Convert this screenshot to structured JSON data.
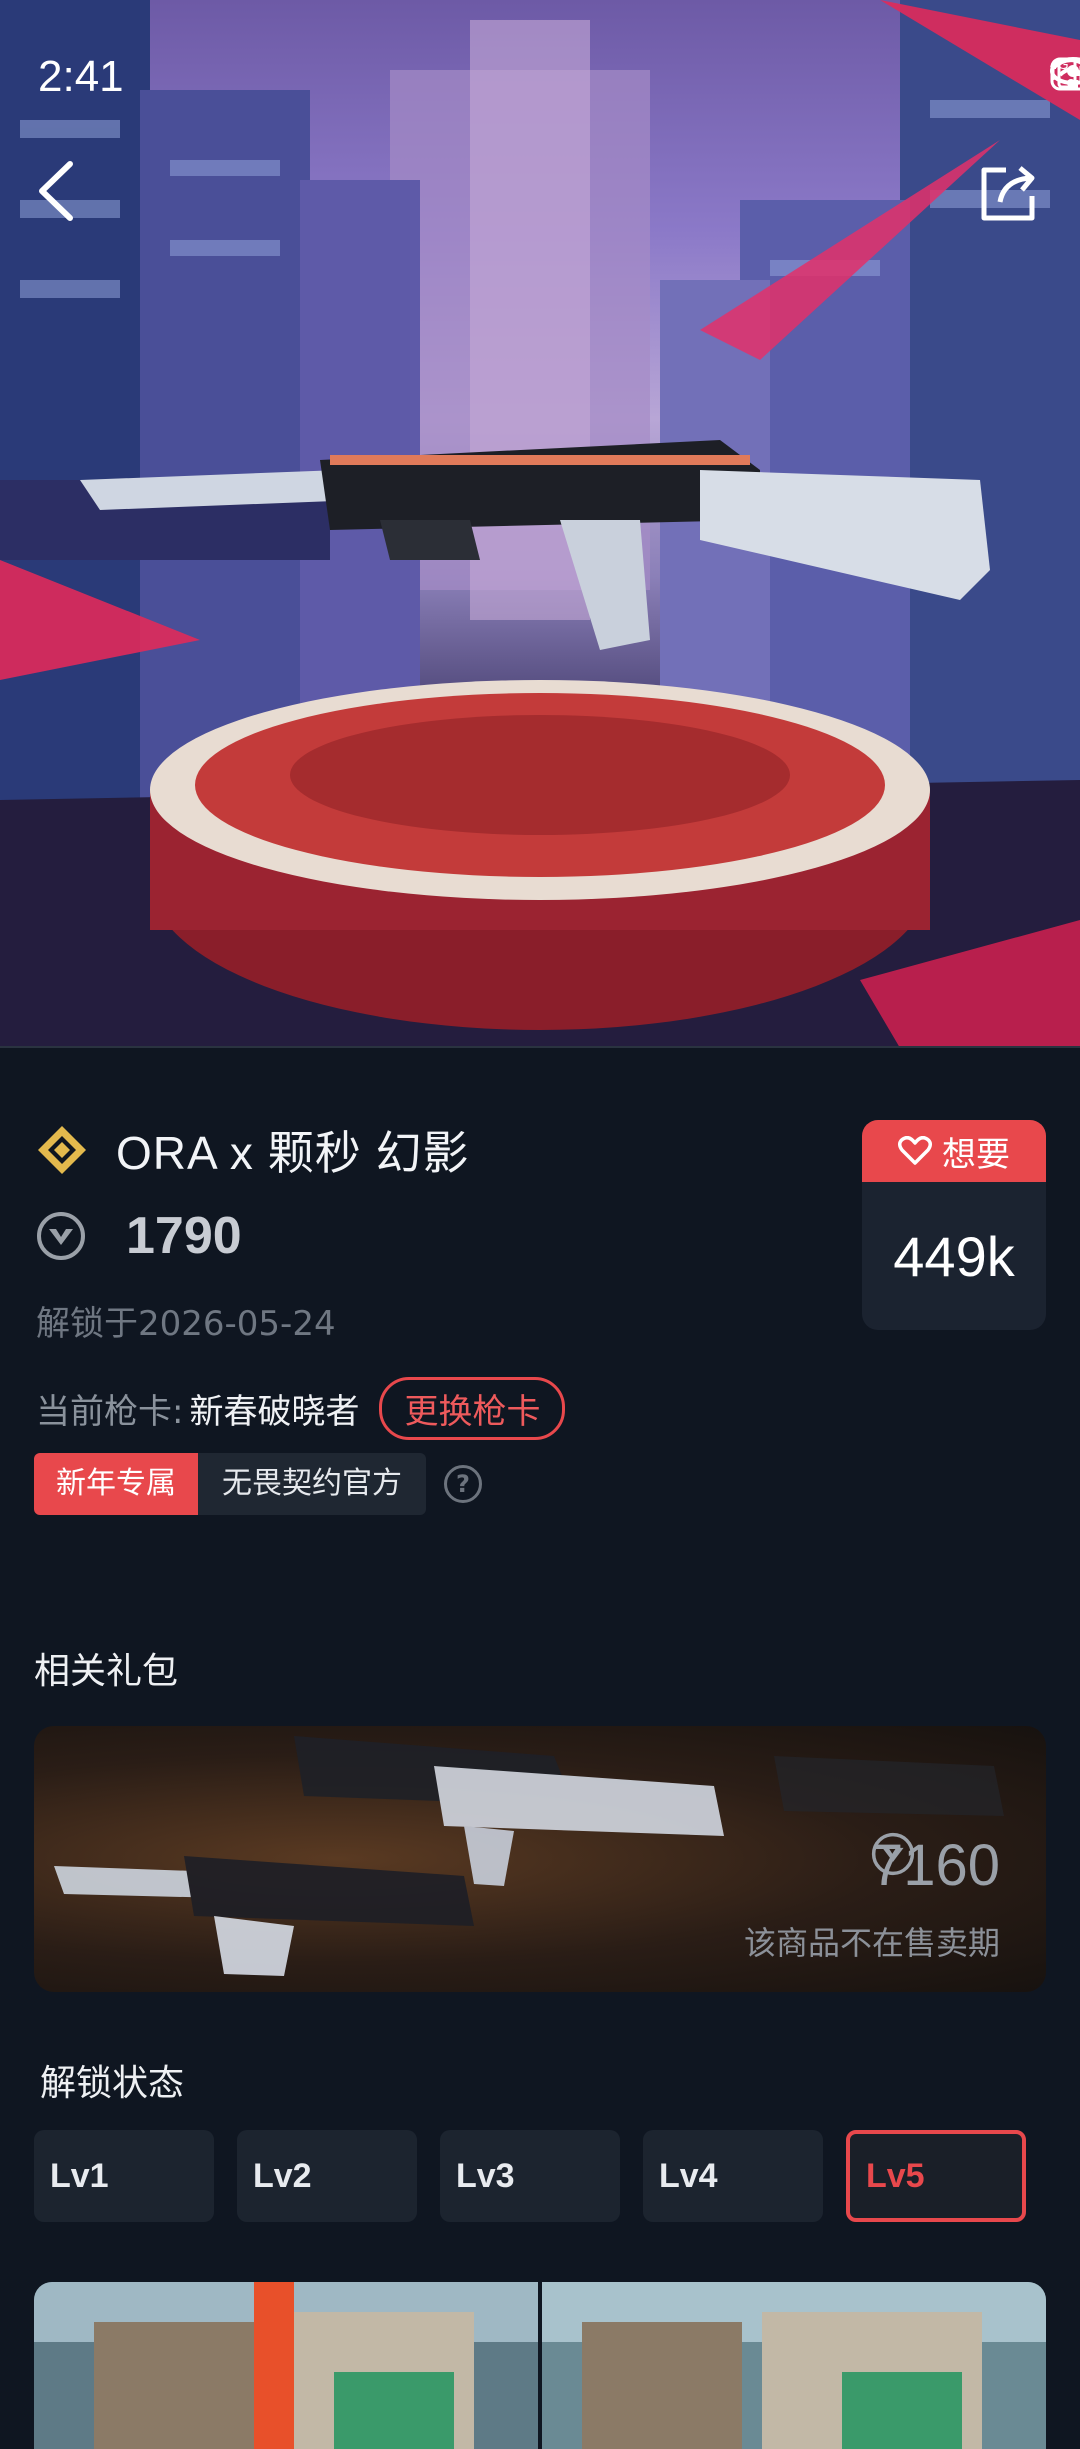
{
  "status_bar": {
    "time": "2:41",
    "signal_label": "4G",
    "signal_superscript": "6"
  },
  "item": {
    "title": "ORA x 颗秒 幻影",
    "price": "1790",
    "unlock_date": "解锁于2026-05-24",
    "current_card_label": "当前枪卡:",
    "current_card_name": "新春破晓者",
    "change_card_label": "更换枪卡",
    "tags": [
      "新年专属",
      "无畏契约官方"
    ],
    "help": "?"
  },
  "want": {
    "label": "想要",
    "count": "449k"
  },
  "bundle_section": {
    "title": "相关礼包",
    "price": "7160",
    "note": "该商品不在售卖期"
  },
  "unlock_section": {
    "title": "解锁状态",
    "levels": [
      "Lv1",
      "Lv2",
      "Lv3",
      "Lv4",
      "Lv5"
    ],
    "selected": "Lv5"
  },
  "colors": {
    "accent": "#e8484c",
    "background": "#0f1621",
    "card": "#1c242f"
  },
  "icons": [
    "back-arrow-icon",
    "share-icon",
    "diamond-rarity-icon",
    "valorant-points-icon",
    "heart-icon",
    "help-icon"
  ]
}
